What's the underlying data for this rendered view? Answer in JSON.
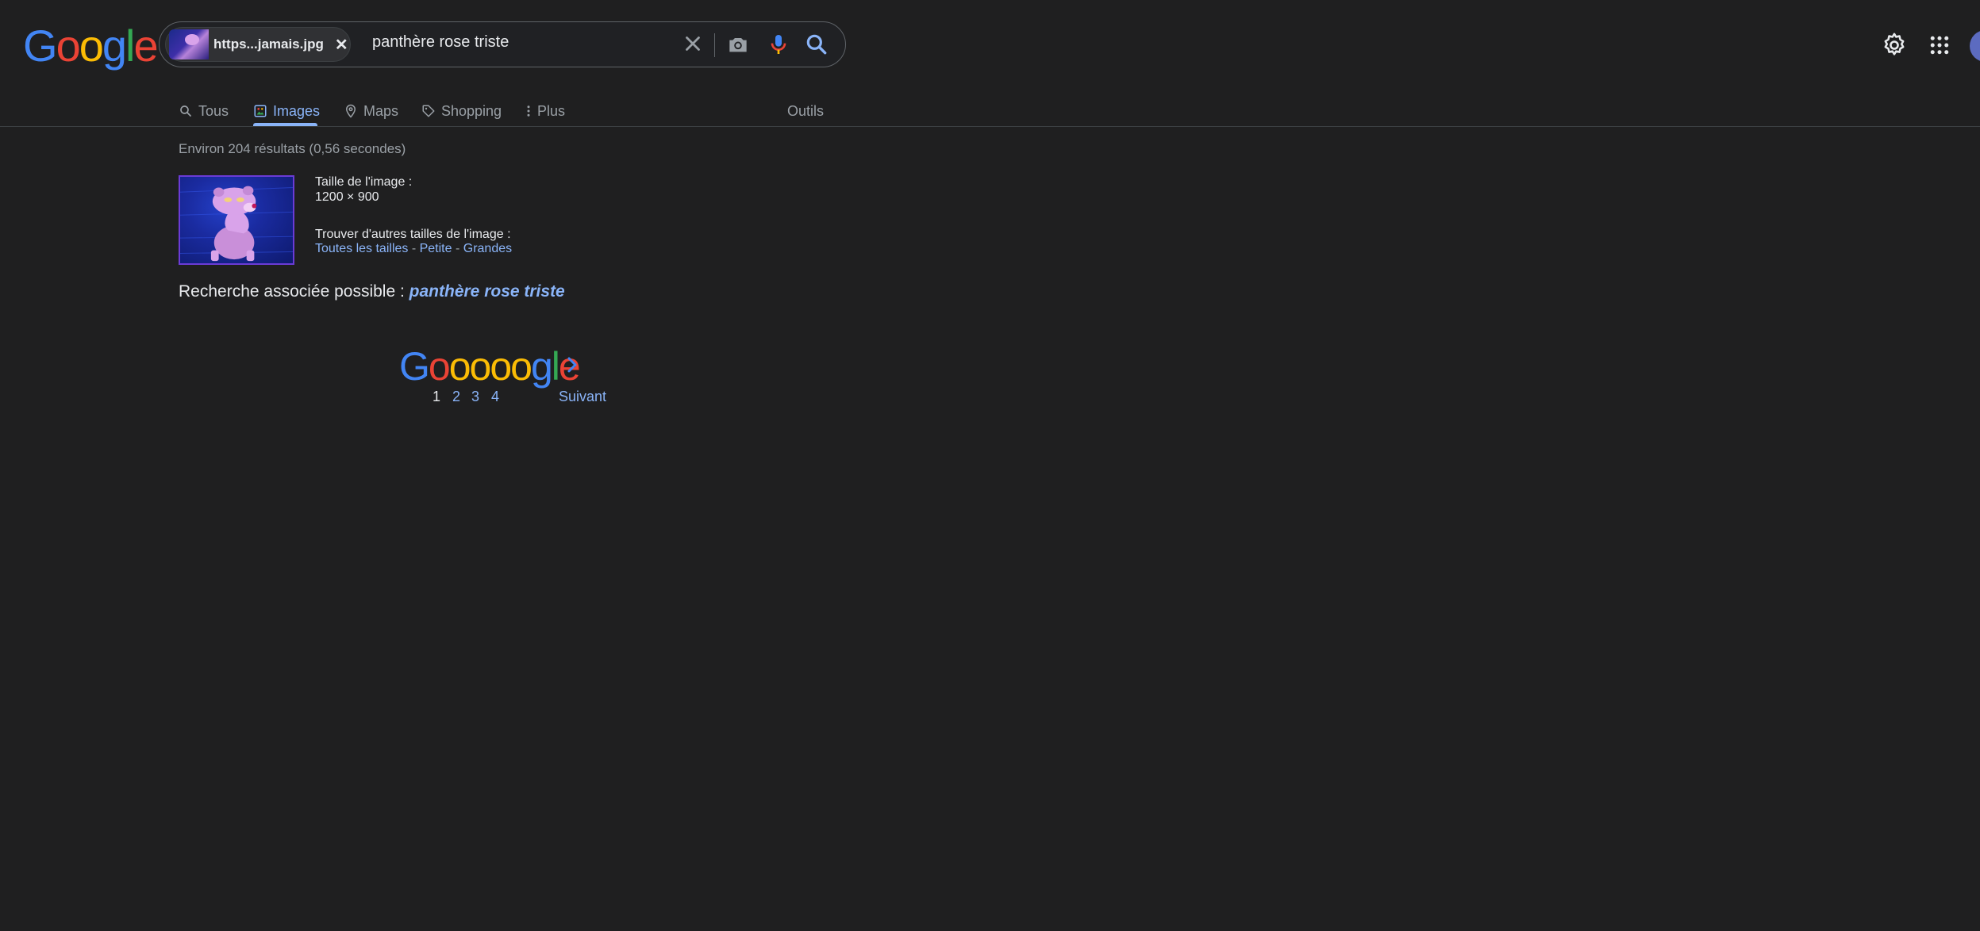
{
  "header": {
    "logo": {
      "l1": "G",
      "l2": "o",
      "l3": "o",
      "l4": "g",
      "l5": "l",
      "l6": "e"
    },
    "chip_label": "https...jamais.jpg",
    "query": "panthère rose triste"
  },
  "tabs": [
    {
      "label": "Tous"
    },
    {
      "label": "Images"
    },
    {
      "label": "Maps"
    },
    {
      "label": "Shopping"
    },
    {
      "label": "Plus"
    },
    {
      "label": "Outils"
    }
  ],
  "results": {
    "stats": "Environ 204 résultats (0,56 secondes)",
    "size_label": "Taille de l'image :",
    "size_value": "1200 × 900",
    "other_sizes_label": "Trouver d'autres tailles de l'image :",
    "size_links": {
      "all": "Toutes les tailles",
      "sep": " - ",
      "small": "Petite",
      "large": "Grandes"
    },
    "related_prefix": "Recherche associée possible : ",
    "related_query": "panthère rose triste"
  },
  "pagination": {
    "logo": {
      "l1": "G",
      "l2": "o",
      "l3": "o",
      "l4": "o",
      "l5": "o",
      "l6": "o",
      "l7": "g",
      "l8": "l",
      "l9": "e"
    },
    "pages": [
      "1",
      "2",
      "3",
      "4"
    ],
    "next_label": "Suivant"
  },
  "colors": {
    "background": "#1f1f20",
    "link": "#8ab4f8",
    "text": "#e8eaed",
    "muted": "#9aa0a6"
  }
}
